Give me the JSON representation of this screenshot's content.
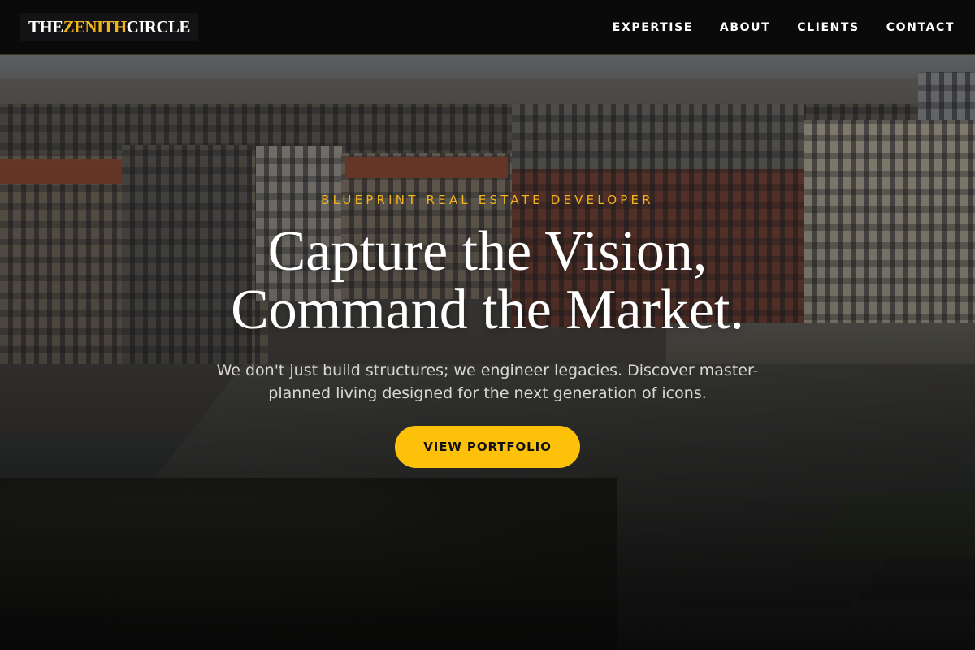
{
  "brand": {
    "name_part1": "THE ",
    "name_accent": "ZENITH",
    "name_part2": " CIRCLE",
    "accent_color": "#f3b41b"
  },
  "nav": {
    "items": [
      {
        "label": "EXPERTISE"
      },
      {
        "label": "ABOUT"
      },
      {
        "label": "CLIENTS"
      },
      {
        "label": "CONTACT"
      }
    ]
  },
  "hero": {
    "eyebrow": "BLUEPRINT REAL ESTATE DEVELOPER",
    "headline_line1": "Capture the Vision,",
    "headline_line2": "Command the Market.",
    "subtext": "We don't just build structures; we engineer legacies. Discover master-planned living designed for the next generation of icons.",
    "cta_label": "VIEW PORTFOLIO",
    "cta_color": "#fdc10a",
    "background": "aerial-city-river-bridge-photo"
  }
}
